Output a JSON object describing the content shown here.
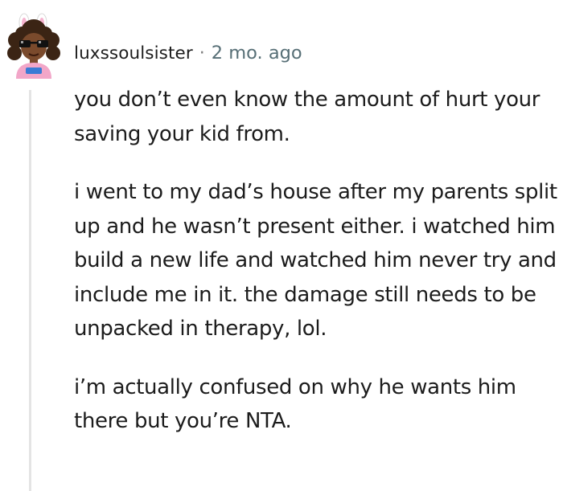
{
  "comment": {
    "author": "luxssoulsister",
    "separator": "·",
    "age": "2 mo. ago",
    "paragraphs": [
      "you don’t even know the amount of hurt your saving your kid from.",
      "i went to my dad’s house after my parents split up and he wasn’t present either. i watched him build a new life and watched him never try and include me in it. the damage still needs to be unpacked in therapy, lol.",
      "i’m actually confused on why he wants him there but you’re NTA."
    ]
  },
  "colors": {
    "text": "#1c1c1c",
    "meta": "#576f76",
    "thread_line": "#e4e4e4",
    "avatar_skin": "#7a4a2c",
    "avatar_hair": "#3b2414",
    "avatar_shirt": "#f2a6c8"
  },
  "icons": {
    "avatar": "user-avatar-bunny-ears-sunglasses"
  }
}
